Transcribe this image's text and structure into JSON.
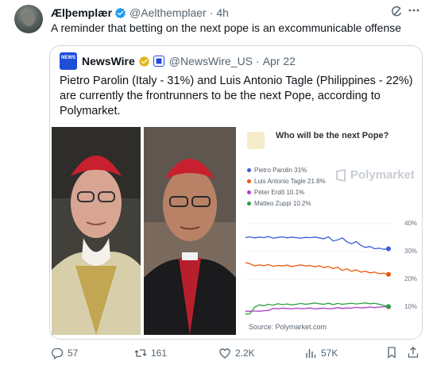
{
  "tweet": {
    "author_name": "Ælþemplær",
    "handle": "@Aelthemplaer",
    "time": "4h",
    "text": "A reminder that betting on the next pope is an excommunicable offense"
  },
  "quote": {
    "avatar_text": "NEWS WIRE",
    "name": "NewsWire",
    "handle": "@NewsWire_US",
    "time": "Apr 22",
    "text": "Pietro Parolin (Italy - 31%) and Luis Antonio Tagle (Philippines - 22%) are currently the frontrunners to be the next Pope, according to Polymarket."
  },
  "actions": {
    "replies": "57",
    "reposts": "161",
    "likes": "2.2K",
    "views": "57K"
  },
  "chart_data": {
    "type": "line",
    "title": "Who will be the next Pope?",
    "brand": "Polymarket",
    "source": "Source: Polymarket.com",
    "yticks": [
      "40%",
      "30%",
      "20%",
      "10%"
    ],
    "ylim": [
      0,
      42
    ],
    "series": [
      {
        "name": "Pietro Parolin 31%",
        "color": "#3b5bdb",
        "values": [
          35,
          35.3,
          34.9,
          35.2,
          35.0,
          35.4,
          34.8,
          35.1,
          35.3,
          34.9,
          35.2,
          35.0,
          34.8,
          35.1,
          35.0,
          35.2,
          34.9,
          34.6,
          35.3,
          33.8,
          34.2,
          34.9,
          33.5,
          32.8,
          33.6,
          32.2,
          31.5,
          31.8,
          31.0,
          31.2,
          30.8,
          31.0
        ]
      },
      {
        "name": "Luis Antonio Tagle 21.8%",
        "color": "#e8590c",
        "values": [
          26,
          25.6,
          24.8,
          25.2,
          24.9,
          25.3,
          24.7,
          25.0,
          24.8,
          25.1,
          24.6,
          24.9,
          25.2,
          24.8,
          25.0,
          24.5,
          24.9,
          24.2,
          24.6,
          23.9,
          24.3,
          23.2,
          23.8,
          22.9,
          23.4,
          22.6,
          22.9,
          22.3,
          22.6,
          22.0,
          22.2,
          21.8
        ]
      },
      {
        "name": "Péter Erdő 10.1%",
        "color": "#ae3ec9",
        "values": [
          8.5,
          8.5,
          8.6,
          8.5,
          8.7,
          8.8,
          9.5,
          9.4,
          9.6,
          9.5,
          9.3,
          9.6,
          9.4,
          9.5,
          9.7,
          9.3,
          9.5,
          9.6,
          9.4,
          9.5,
          9.8,
          9.5,
          9.7,
          9.6,
          9.9,
          9.7,
          9.8,
          10.0,
          9.8,
          10.0,
          10.1,
          10.1
        ]
      },
      {
        "name": "Matteo Zuppi 10.2%",
        "color": "#2f9e44",
        "values": [
          7.5,
          7.6,
          10.0,
          10.8,
          10.5,
          11.0,
          10.7,
          11.2,
          10.9,
          11.1,
          10.8,
          11.0,
          11.3,
          11.0,
          11.2,
          11.5,
          11.2,
          11.0,
          11.4,
          10.9,
          11.3,
          11.0,
          11.2,
          11.4,
          11.1,
          11.3,
          11.5,
          11.2,
          11.4,
          11.0,
          10.6,
          10.2
        ]
      }
    ]
  }
}
